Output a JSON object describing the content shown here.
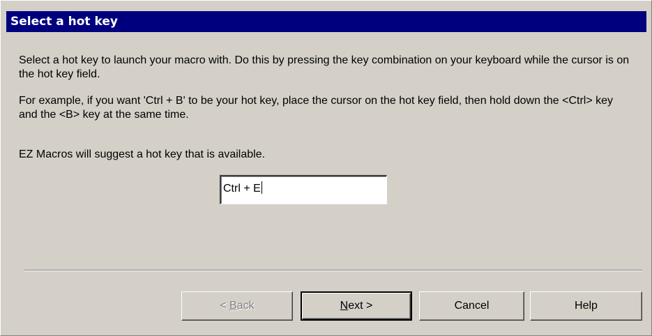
{
  "title": "Select a hot key",
  "instructions": {
    "p1": "Select a hot key to launch your macro with.  Do this by pressing the key combination on your keyboard while the cursor is on the hot key field.",
    "p2": "For example, if you want 'Ctrl + B' to be your hot key, place the cursor on the hot key field, then hold down the <Ctrl> key and the <B> key at the same time.",
    "p3": "EZ Macros will suggest a hot key that is available."
  },
  "hotkey_field": {
    "value": "Ctrl + E"
  },
  "buttons": {
    "back": {
      "prefix": "< ",
      "accel": "B",
      "rest": "ack",
      "enabled": false
    },
    "next": {
      "accel": "N",
      "rest": "ext >",
      "default": true
    },
    "cancel": "Cancel",
    "help": "Help"
  },
  "colors": {
    "titlebar_bg": "#00007f",
    "titlebar_text": "#ffffff",
    "dialog_bg": "#d4d0c8",
    "disabled_text": "#808080"
  }
}
